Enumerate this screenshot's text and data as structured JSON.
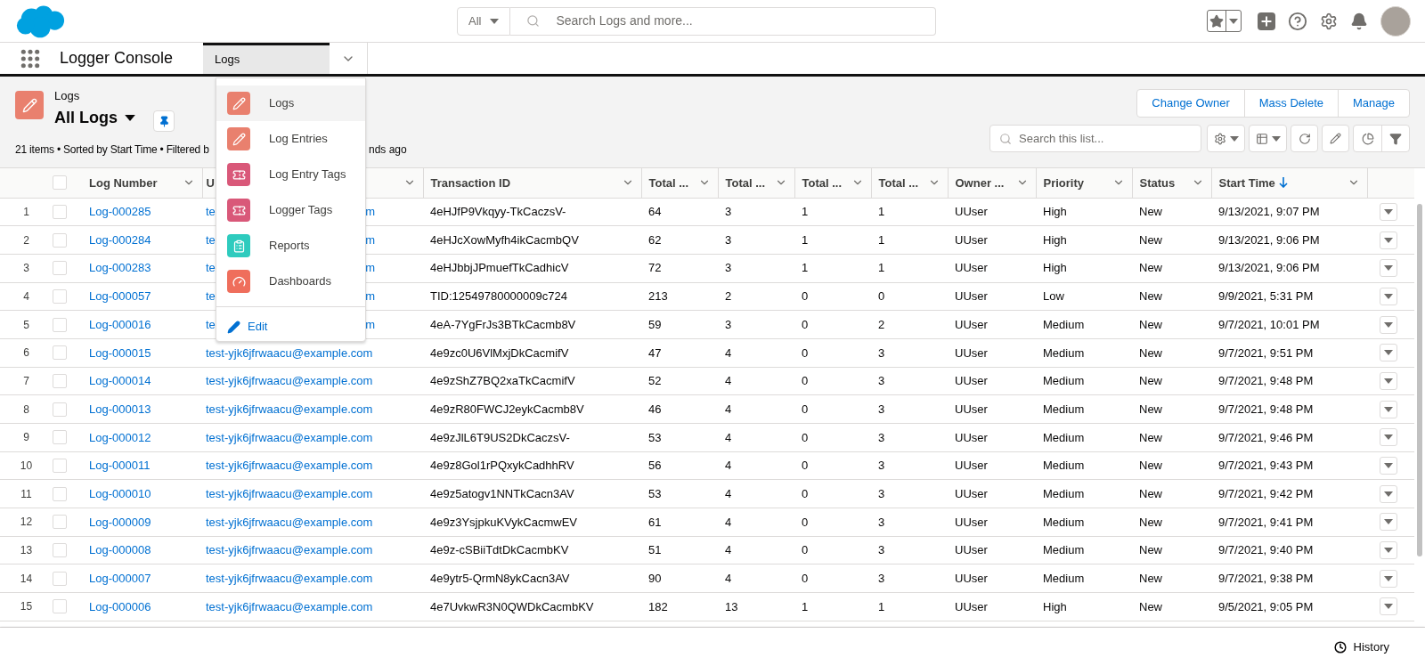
{
  "global_search": {
    "scope": "All",
    "placeholder": "Search Logs and more..."
  },
  "app_name": "Logger Console",
  "nav_tabs": [
    {
      "label": "Logs",
      "selected": true
    }
  ],
  "nav_menu": {
    "items": [
      {
        "label": "Logs",
        "kind": "object",
        "color": "#e9806e",
        "selected": true
      },
      {
        "label": "Log Entries",
        "kind": "object",
        "color": "#e9806e",
        "selected": false
      },
      {
        "label": "Log Entry Tags",
        "kind": "tag",
        "color": "#d95879",
        "selected": false
      },
      {
        "label": "Logger Tags",
        "kind": "tag",
        "color": "#d95879",
        "selected": false
      },
      {
        "label": "Reports",
        "kind": "report",
        "color": "#2ecbbe",
        "selected": false
      },
      {
        "label": "Dashboards",
        "kind": "dashboard",
        "color": "#ef6e5c",
        "selected": false
      }
    ],
    "edit": "Edit"
  },
  "list_header": {
    "object": "Logs",
    "view": "All Logs",
    "summary_parts": [
      "21 items • Sorted by Start Time • Filtered b",
      "nds ago"
    ]
  },
  "actions": [
    "Change Owner",
    "Mass Delete",
    "Manage"
  ],
  "list_search": {
    "placeholder": "Search this list..."
  },
  "table": {
    "select_all": {
      "selected": false
    },
    "columns": [
      {
        "label": "Log Number"
      },
      {
        "label": "U"
      },
      {
        "label": "Transaction ID"
      },
      {
        "label": "Total ..."
      },
      {
        "label": "Total ..."
      },
      {
        "label": "Total ..."
      },
      {
        "label": "Total ..."
      },
      {
        "label": "Owner ..."
      },
      {
        "label": "Priority"
      },
      {
        "label": "Status"
      },
      {
        "label": "Start Time",
        "sorted_descending": true
      }
    ],
    "rows": [
      {
        "index": "1",
        "selected": false,
        "cells": [
          "Log-000285",
          [
            "te",
            "m"
          ],
          "4eHJfP9Vkqyy-TkCaczsV-",
          "64",
          "3",
          "1",
          "1",
          "UUser",
          "High",
          "New",
          "9/13/2021, 9:07 PM"
        ]
      },
      {
        "index": "2",
        "selected": false,
        "cells": [
          "Log-000284",
          [
            "te",
            "m"
          ],
          "4eHJcXowMyfh4ikCacmbQV",
          "62",
          "3",
          "1",
          "1",
          "UUser",
          "High",
          "New",
          "9/13/2021, 9:06 PM"
        ]
      },
      {
        "index": "3",
        "selected": false,
        "cells": [
          "Log-000283",
          [
            "te",
            "m"
          ],
          "4eHJbbjJPmuefTkCadhicV",
          "72",
          "3",
          "1",
          "1",
          "UUser",
          "High",
          "New",
          "9/13/2021, 9:06 PM"
        ]
      },
      {
        "index": "4",
        "selected": false,
        "cells": [
          "Log-000057",
          [
            "te",
            "m"
          ],
          "TID:12549780000009c724",
          "213",
          "2",
          "0",
          "0",
          "UUser",
          "Low",
          "New",
          "9/9/2021, 5:31 PM"
        ]
      },
      {
        "index": "5",
        "selected": false,
        "cells": [
          "Log-000016",
          [
            "te",
            "m"
          ],
          "4eA-7YgFrJs3BTkCacmb8V",
          "59",
          "3",
          "0",
          "2",
          "UUser",
          "Medium",
          "New",
          "9/7/2021, 10:01 PM"
        ]
      },
      {
        "index": "6",
        "selected": false,
        "cells": [
          "Log-000015",
          [
            "test-yjk6jfrwaacu@example.com"
          ],
          "4e9zc0U6VlMxjDkCacmifV",
          "47",
          "4",
          "0",
          "3",
          "UUser",
          "Medium",
          "New",
          "9/7/2021, 9:51 PM"
        ]
      },
      {
        "index": "7",
        "selected": false,
        "cells": [
          "Log-000014",
          [
            "test-yjk6jfrwaacu@example.com"
          ],
          "4e9zShZ7BQ2xaTkCacmifV",
          "52",
          "4",
          "0",
          "3",
          "UUser",
          "Medium",
          "New",
          "9/7/2021, 9:48 PM"
        ]
      },
      {
        "index": "8",
        "selected": false,
        "cells": [
          "Log-000013",
          [
            "test-yjk6jfrwaacu@example.com"
          ],
          "4e9zR80FWCJ2eykCacmb8V",
          "46",
          "4",
          "0",
          "3",
          "UUser",
          "Medium",
          "New",
          "9/7/2021, 9:48 PM"
        ]
      },
      {
        "index": "9",
        "selected": false,
        "cells": [
          "Log-000012",
          [
            "test-yjk6jfrwaacu@example.com"
          ],
          "4e9zJlL6T9US2DkCaczsV-",
          "53",
          "4",
          "0",
          "3",
          "UUser",
          "Medium",
          "New",
          "9/7/2021, 9:46 PM"
        ]
      },
      {
        "index": "10",
        "selected": false,
        "cells": [
          "Log-000011",
          [
            "test-yjk6jfrwaacu@example.com"
          ],
          "4e9z8Gol1rPQxykCadhhRV",
          "56",
          "4",
          "0",
          "3",
          "UUser",
          "Medium",
          "New",
          "9/7/2021, 9:43 PM"
        ]
      },
      {
        "index": "11",
        "selected": false,
        "cells": [
          "Log-000010",
          [
            "test-yjk6jfrwaacu@example.com"
          ],
          "4e9z5atogv1NNTkCacn3AV",
          "53",
          "4",
          "0",
          "3",
          "UUser",
          "Medium",
          "New",
          "9/7/2021, 9:42 PM"
        ]
      },
      {
        "index": "12",
        "selected": false,
        "cells": [
          "Log-000009",
          [
            "test-yjk6jfrwaacu@example.com"
          ],
          "4e9z3YsjpkuKVykCacmwEV",
          "61",
          "4",
          "0",
          "3",
          "UUser",
          "Medium",
          "New",
          "9/7/2021, 9:41 PM"
        ]
      },
      {
        "index": "13",
        "selected": false,
        "cells": [
          "Log-000008",
          [
            "test-yjk6jfrwaacu@example.com"
          ],
          "4e9z-cSBiiTdtDkCacmbKV",
          "51",
          "4",
          "0",
          "3",
          "UUser",
          "Medium",
          "New",
          "9/7/2021, 9:40 PM"
        ]
      },
      {
        "index": "14",
        "selected": false,
        "cells": [
          "Log-000007",
          [
            "test-yjk6jfrwaacu@example.com"
          ],
          "4e9ytr5-QrmN8ykCacn3AV",
          "90",
          "4",
          "0",
          "3",
          "UUser",
          "Medium",
          "New",
          "9/7/2021, 9:38 PM"
        ]
      },
      {
        "index": "15",
        "selected": false,
        "cells": [
          "Log-000006",
          [
            "test-yjk6jfrwaacu@example.com"
          ],
          "4e7UvkwR3N0QWDkCacmbKV",
          "182",
          "13",
          "1",
          "1",
          "UUser",
          "High",
          "New",
          "9/5/2021, 9:05 PM"
        ]
      }
    ]
  },
  "utility_bar": {
    "history": "History"
  }
}
